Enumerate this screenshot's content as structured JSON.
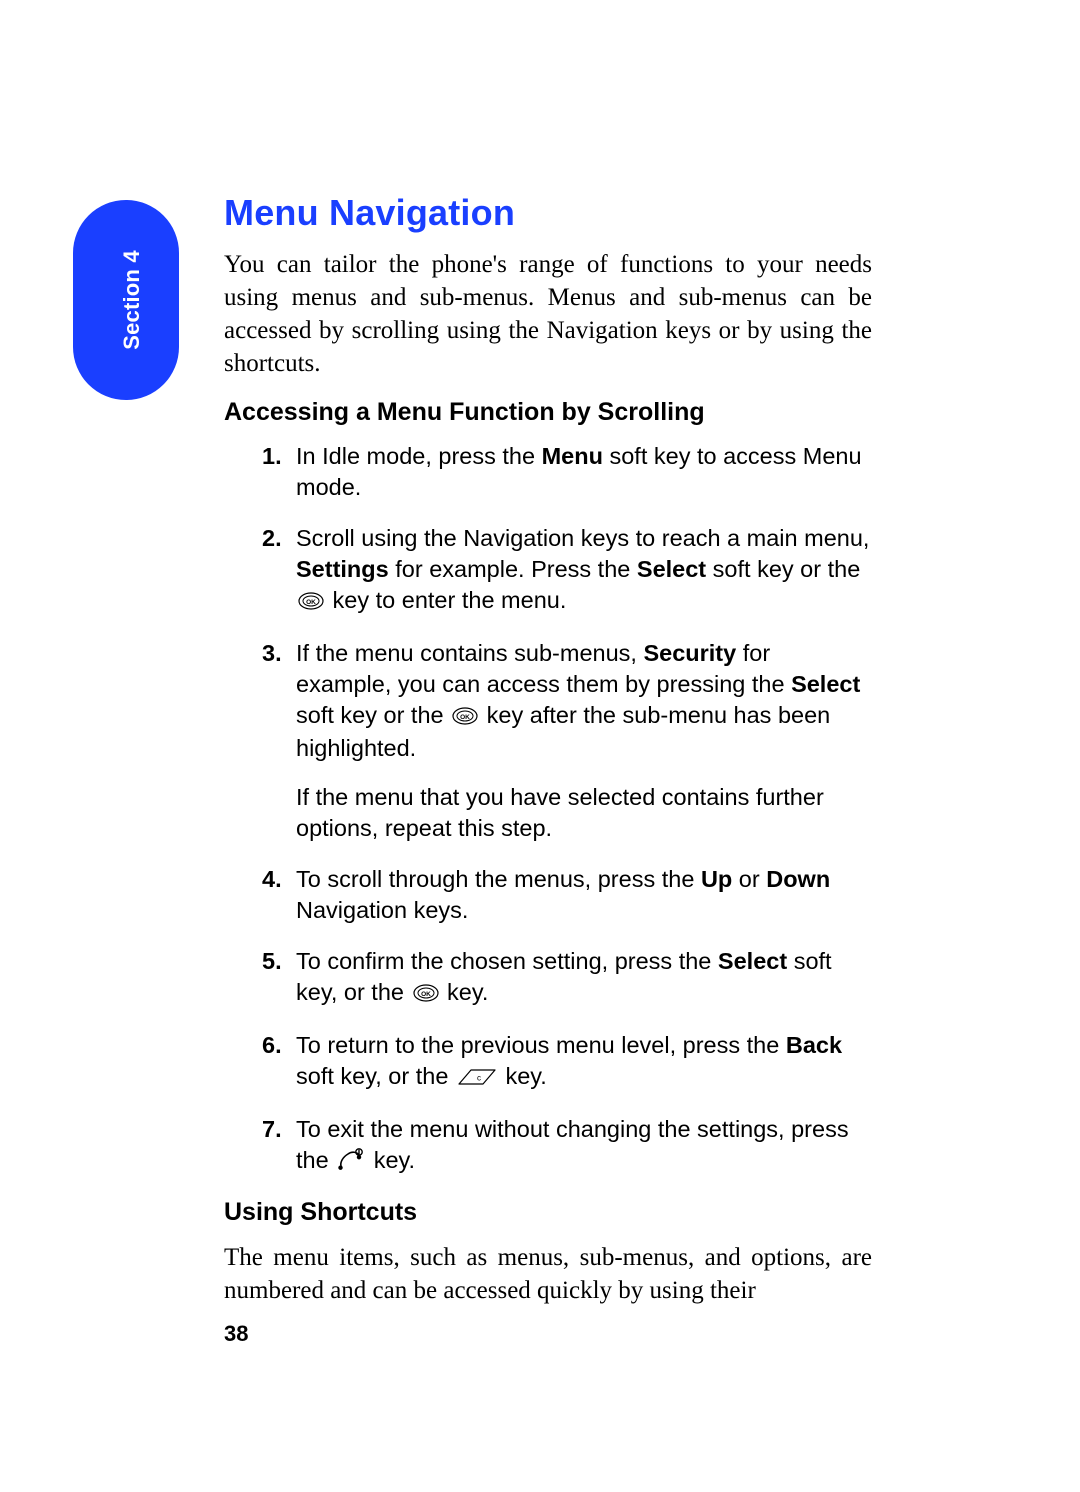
{
  "section_tab": {
    "label": "Section 4"
  },
  "title": "Menu Navigation",
  "intro": "You can tailor the phone's range of functions to your needs using menus and sub-menus. Menus and sub-menus can be accessed by scrolling using the Navigation keys or by using the shortcuts.",
  "sub1": "Accessing a Menu Function by Scrolling",
  "steps": {
    "s1": {
      "a": "In Idle mode, press the ",
      "menu": "Menu",
      "b": " soft key to access Menu mode."
    },
    "s2": {
      "a": "Scroll using the Navigation keys to reach a main menu, ",
      "settings": "Settings",
      "b": " for example. Press the ",
      "select": "Select",
      "c": " soft key or the ",
      "d": " key to enter the menu."
    },
    "s3": {
      "a": "If the menu contains sub-menus, ",
      "security": "Security",
      "b": " for example, you can access them by pressing the ",
      "select": "Select",
      "c": " soft key or the ",
      "d": " key after the sub-menu has been highlighted.",
      "after": "If the menu that you have selected contains further options, repeat this step."
    },
    "s4": {
      "a": "To scroll through the menus, press the ",
      "up": "Up",
      "b": " or ",
      "down": "Down",
      "c": " Navigation keys."
    },
    "s5": {
      "a": "To confirm the chosen setting, press the ",
      "select": "Select",
      "b": " soft key, or the ",
      "c": " key."
    },
    "s6": {
      "a": "To return to the previous menu level, press the ",
      "back": "Back",
      "b": " soft key, or the ",
      "c": " key."
    },
    "s7": {
      "a": "To exit the menu without changing the settings, press the ",
      "b": " key."
    }
  },
  "sub2": "Using Shortcuts",
  "shortcuts_body": "The menu items, such as menus, sub-menus, and options, are numbered and can be accessed quickly by using their",
  "page_number": "38"
}
